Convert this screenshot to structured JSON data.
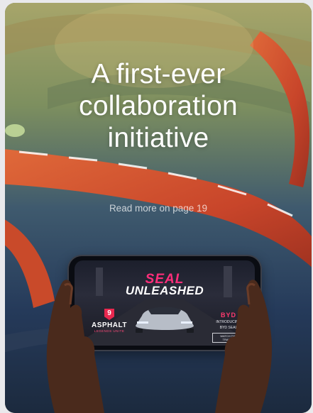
{
  "headline": {
    "line1": "A first-ever",
    "line2": "collaboration",
    "line3": "initiative"
  },
  "read_more": "Read more on page 19",
  "phone_screen": {
    "seal": "SEAL",
    "unleashed": "UNLEASHED",
    "asphalt_badge": "9",
    "asphalt_title": "ASPHALT",
    "asphalt_subtitle": "LEGENDS UNITE",
    "byd_logo": "BYD",
    "byd_intro_line1": "INTRODUCING",
    "byd_intro_line2": "BYD SEAL",
    "watch_button": "WATCH THE TRAILER"
  },
  "colors": {
    "track_orange": "#d9512a",
    "accent_pink": "#ff2e7a",
    "card_bg": "#6f7a55"
  }
}
